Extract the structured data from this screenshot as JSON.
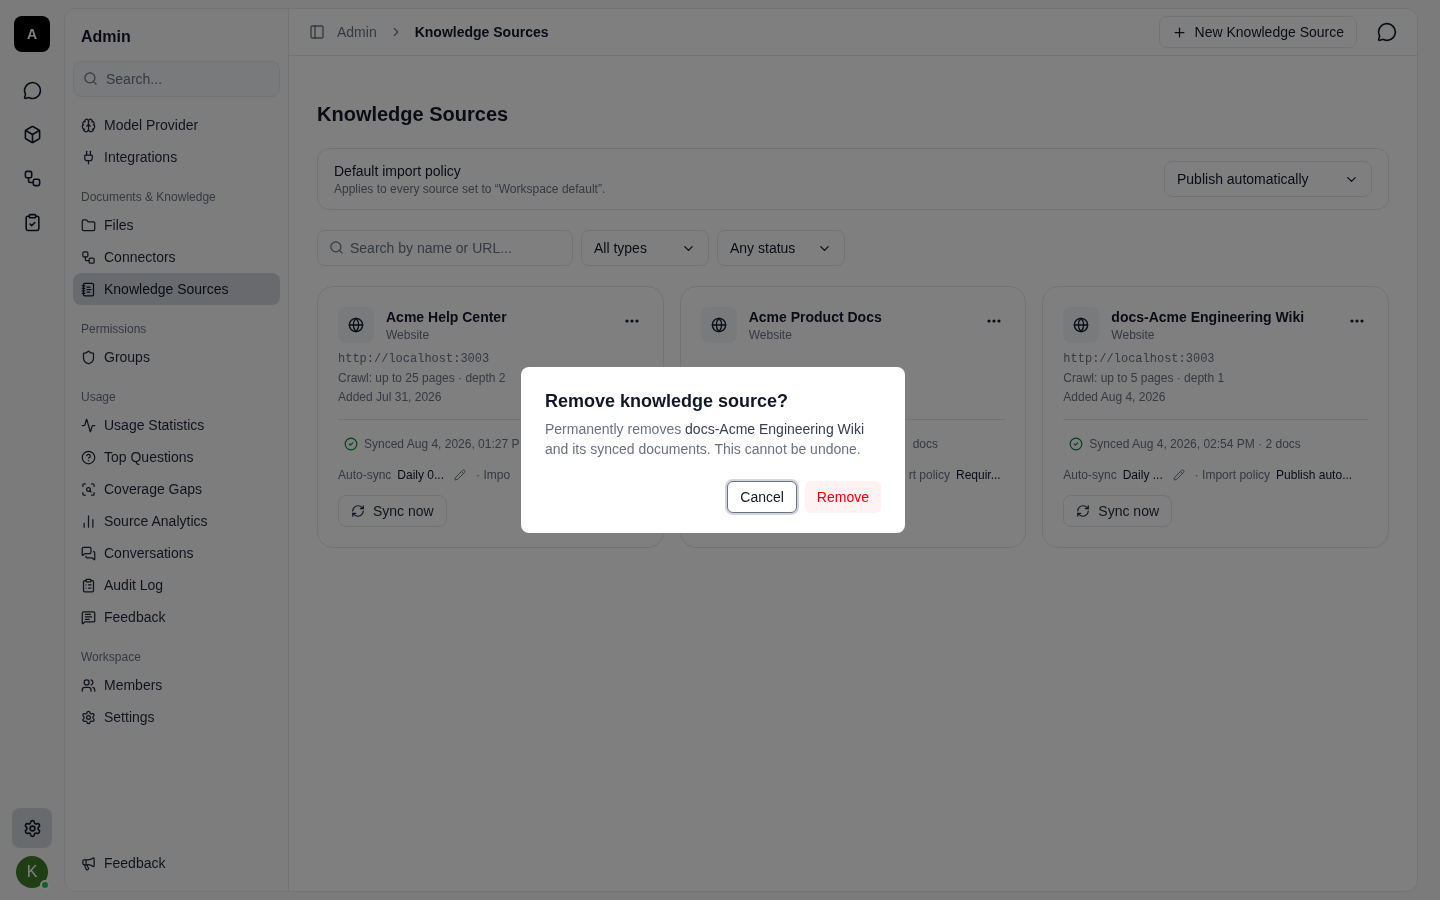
{
  "rail": {
    "logo": "A",
    "buttons": [
      {
        "selected": false
      },
      {
        "selected": false
      },
      {
        "selected": false
      },
      {
        "selected": false
      }
    ],
    "settings": {
      "selected": true
    },
    "avatar": {
      "initial": "K",
      "online": true
    }
  },
  "sidebar": {
    "title": "Admin",
    "search": {
      "placeholder": "Search..."
    },
    "sections": [
      {
        "items": [
          {
            "label": "Model Provider",
            "selected": false
          },
          {
            "label": "Integrations",
            "selected": false
          }
        ]
      },
      {
        "heading": "Documents & Knowledge",
        "items": [
          {
            "label": "Files",
            "selected": false
          },
          {
            "label": "Connectors",
            "selected": false
          },
          {
            "label": "Knowledge Sources",
            "selected": true
          }
        ]
      },
      {
        "heading": "Permissions",
        "items": [
          {
            "label": "Groups",
            "selected": false
          }
        ]
      },
      {
        "heading": "Usage",
        "items": [
          {
            "label": "Usage Statistics",
            "selected": false
          },
          {
            "label": "Top Questions",
            "selected": false
          },
          {
            "label": "Coverage Gaps",
            "selected": false
          },
          {
            "label": "Source Analytics",
            "selected": false
          },
          {
            "label": "Conversations",
            "selected": false
          },
          {
            "label": "Audit Log",
            "selected": false
          },
          {
            "label": "Feedback",
            "selected": false
          }
        ]
      },
      {
        "heading": "Workspace",
        "items": [
          {
            "label": "Members",
            "selected": false
          },
          {
            "label": "Settings",
            "selected": false
          }
        ]
      }
    ],
    "footer": {
      "label": "Feedback"
    }
  },
  "header": {
    "breadcrumb": [
      "Admin",
      "Knowledge Sources"
    ],
    "new_button": "New Knowledge Source"
  },
  "page": {
    "title": "Knowledge Sources",
    "policy": {
      "title": "Default import policy",
      "description": "Applies to every source set to “Workspace default”.",
      "value": "Publish automatically"
    },
    "filters": {
      "search_placeholder": "Search by name or URL...",
      "dropdowns": [
        "All types",
        "Any status"
      ]
    },
    "cards": [
      {
        "name": "Acme Help Center",
        "type": "Website",
        "url": "http://localhost:3003",
        "crawl": "Crawl: up to 25 pages · depth 2",
        "added": "Added Jul 31, 2026",
        "synced": true,
        "sync_text": "Synced Aug 4, 2026, 01:27 P",
        "autosync_label": "Auto-sync",
        "autosync_value": "Daily 0...",
        "import_label": "· Impo",
        "sync_button": "Sync now"
      },
      {
        "name": "Acme Product Docs",
        "type": "Website",
        "sync_text": "docs",
        "import_label": "rt policy",
        "import_value": "Requir..."
      },
      {
        "name": "docs-Acme Engineering Wiki",
        "type": "Website",
        "url": "http://localhost:3003",
        "crawl": "Crawl: up to 5 pages · depth 1",
        "added": "Added Aug 4, 2026",
        "synced": true,
        "sync_text": "Synced Aug 4, 2026, 02:54 PM · 2 docs",
        "autosync_label": "Auto-sync",
        "autosync_value": "Daily ...",
        "import_label": "· Import policy",
        "import_value": "Publish auto...",
        "sync_button": "Sync now"
      }
    ]
  },
  "dialog": {
    "title": "Remove knowledge source?",
    "body": "Permanently removes **docs-Acme Engineering Wiki** and its synced documents. This cannot be undone.",
    "cancel": {
      "label": "Cancel",
      "focused": true
    },
    "remove": "Remove"
  }
}
